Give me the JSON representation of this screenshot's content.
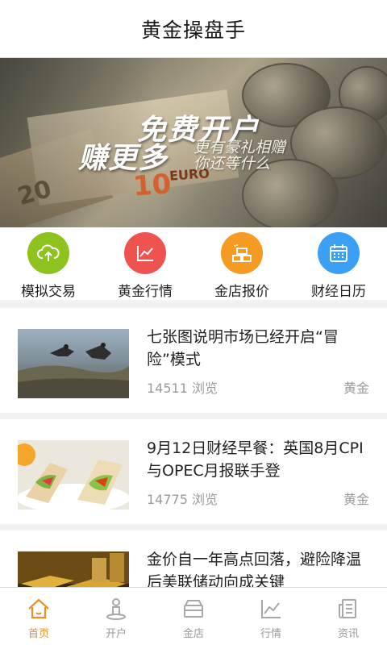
{
  "header": {
    "title": "黄金操盘手"
  },
  "banner": {
    "line1": "免费开户",
    "line2": "赚更多",
    "sub1": "更有豪礼相赠",
    "sub2": "你还等什么",
    "bill_number": "10",
    "bill_currency": "EURO",
    "bill_number_2": "20"
  },
  "colors": {
    "accent": "#f08c1e",
    "icon_green": "#8dc21f",
    "icon_red": "#ef5350",
    "icon_orange": "#f59a23",
    "icon_blue": "#3a9ff5"
  },
  "quick_actions": [
    {
      "label": "模拟交易",
      "icon": "cloud-upload-icon"
    },
    {
      "label": "黄金行情",
      "icon": "line-chart-icon"
    },
    {
      "label": "金店报价",
      "icon": "gold-bars-icon"
    },
    {
      "label": "财经日历",
      "icon": "calendar-icon"
    }
  ],
  "news": [
    {
      "title": "七张图说明市场已经开启“冒险”模式",
      "views": "14511 浏览",
      "tag": "黄金",
      "thumb": "skydivers-image"
    },
    {
      "title": "9月12日财经早餐：英国8月CPI与OPEC月报联手登",
      "views": "14775 浏览",
      "tag": "黄金",
      "thumb": "wraps-food-image"
    },
    {
      "title": "金价自一年高点回落，避险降温后美联储动向成关键",
      "views": "",
      "tag": "",
      "thumb": "gold-bars-image"
    }
  ],
  "tabs": [
    {
      "label": "首页",
      "icon": "home-icon",
      "active": true
    },
    {
      "label": "开户",
      "icon": "user-open-icon",
      "active": false
    },
    {
      "label": "金店",
      "icon": "store-icon",
      "active": false
    },
    {
      "label": "行情",
      "icon": "chart-icon",
      "active": false
    },
    {
      "label": "资讯",
      "icon": "news-icon",
      "active": false
    }
  ]
}
